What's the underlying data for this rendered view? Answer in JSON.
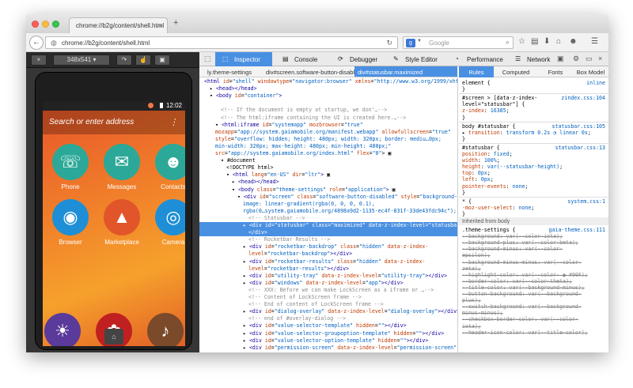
{
  "browser": {
    "tab_title": "chrome://b2g/content/shell.html",
    "url": "chrome://b2g/content/shell.html",
    "search_placeholder": "Google",
    "search_engine": "g"
  },
  "simulator": {
    "size_label": "348x541",
    "status_time": "12:02",
    "search_placeholder": "Search or enter address",
    "apps": [
      {
        "label": "Phone",
        "icon": "phone-icon",
        "glyph": "☏",
        "color": "#2ba897"
      },
      {
        "label": "Messages",
        "icon": "messages-icon",
        "glyph": "✉",
        "color": "#2ba897"
      },
      {
        "label": "Contacts",
        "icon": "contacts-icon",
        "glyph": "☻",
        "color": "#2ba897"
      },
      {
        "label": "Browser",
        "icon": "browser-icon",
        "glyph": "◉",
        "color": "#1e8fd6"
      },
      {
        "label": "Marketplace",
        "icon": "marketplace-icon",
        "glyph": "▲",
        "color": "#e2552a"
      },
      {
        "label": "Camera",
        "icon": "camera-icon",
        "glyph": "◎",
        "color": "#1e8fd6"
      }
    ]
  },
  "devtools": {
    "tabs": [
      "Inspector",
      "Console",
      "Debugger",
      "Style Editor",
      "Performance",
      "Network"
    ],
    "breadcrumbs": [
      "ly.theme-settings",
      "div#screen.software-button-disabled",
      "div#statusbar.maximized"
    ],
    "markup": [
      {
        "html": "<span class='tg'>&lt;html</span> <span class='at'>id</span>=<span class='av'>\"shell\"</span> <span class='at'>windowtype</span>=<span class='av'>\"navigator:browser\"</span> <span class='at'>xmlns</span>=<span class='av'>\"http://www.w3.org/1999/xhtml\"</span>&gt; ▣",
        "indent": 0
      },
      {
        "html": "▸ <span class='tg'>&lt;head&gt;&lt;/head&gt;</span>",
        "indent": 1
      },
      {
        "html": "▾ <span class='tg'>&lt;body</span> <span class='at'>id</span>=<span class='av'>\"container\"</span><span class='tg'>&gt;</span>",
        "indent": 1
      },
      {
        "html": "",
        "indent": 0
      },
      {
        "html": "<span class='cm'>&lt;!--     If the document is empty at startup, we don'…--&gt;</span>",
        "indent": 3
      },
      {
        "html": "<span class='cm'>&lt;!-- The html:iframe containing the UI is created here.…--&gt;</span>",
        "indent": 3
      },
      {
        "html": "▾ <span class='tg'>&lt;html:iframe</span> <span class='at'>id</span>=<span class='av'>\"systemapp\"</span> <span class='at'>mozbrowser</span>=<span class='av'>\"true\"</span>",
        "indent": 2
      },
      {
        "html": "<span class='at'>mozapp</span>=<span class='av'>\"app://system.gaiamobile.org/manifest.webapp\"</span> <span class='at'>allowfullscreen</span>=<span class='av'>\"true\"</span>",
        "indent": 2
      },
      {
        "html": "<span class='at'>style</span>=<span class='av'>\"overflow: hidden; height: 480px; width: 320px; border: mediu…0px;</span>",
        "indent": 2
      },
      {
        "html": "<span class='av'>min-width: 320px; max-height: 480px; min-height: 480px;\"</span>",
        "indent": 2
      },
      {
        "html": "<span class='at'>src</span>=<span class='av'>\"app://system.gaiamobile.org/index.html\"</span> <span class='at'>flex</span>=<span class='av'>\"0\"</span>&gt; ▣",
        "indent": 2
      },
      {
        "html": "▾ #document",
        "indent": 3
      },
      {
        "html": "&lt;!DOCTYPE html&gt;",
        "indent": 4
      },
      {
        "html": "▾ <span class='tg'>&lt;html</span> <span class='at'>lang</span>=<span class='av'>\"en-US\"</span> <span class='at'>dir</span>=<span class='av'>\"ltr\"</span><span class='tg'>&gt;</span> ▣",
        "indent": 4
      },
      {
        "html": "▸ <span class='tg'>&lt;head&gt;&lt;/head&gt;</span>",
        "indent": 5
      },
      {
        "html": "▾ <span class='tg'>&lt;body</span> <span class='at'>class</span>=<span class='av'>\"theme-settings\"</span> <span class='at'>role</span>=<span class='av'>\"application\"</span><span class='tg'>&gt;</span> ▣",
        "indent": 5
      },
      {
        "html": "▾ <span class='tg'>&lt;div</span> <span class='at'>id</span>=<span class='av'>\"screen\"</span> <span class='at'>class</span>=<span class='av'>\"software-button-disabled\"</span> <span class='at'>style</span>=<span class='av'>\"background-</span>",
        "indent": 6
      },
      {
        "html": "<span class='av'>image: linear-gradient(rgba(0, 0, 0, 0.1),</span>",
        "indent": 7
      },
      {
        "html": "<span class='av'>rgba(0…system.gaiamobile.org/4898a9d2-1135-ec4f-831f-33de43fdc94c\");\"</span>&gt; ▣",
        "indent": 7
      },
      {
        "html": "<span class='cm'>&lt;!-- Statusbar --&gt;</span>",
        "indent": 8
      },
      {
        "html": "▸ <span class='tg'>&lt;div</span> <span class='at'>id</span>=<span class='av'>\"statusbar\"</span> <span class='at'>class</span>=<span class='av'>\"maximized\"</span> <span class='at'>data-z-index-level</span>=<span class='av'>\"statusbar\"</span><span class='tg'>&gt;</span>",
        "indent": 7,
        "selected": true
      },
      {
        "html": "<span class='tg'>&lt;/div&gt;</span>",
        "indent": 8,
        "selected": true
      },
      {
        "html": "<span class='cm'>&lt;!-- Rocketbar Results --&gt;</span>",
        "indent": 8
      },
      {
        "html": "▸ <span class='tg'>&lt;div</span> <span class='at'>id</span>=<span class='av'>\"rocketbar-backdrop\"</span> <span class='at'>class</span>=<span class='av'>\"hidden\"</span> <span class='at'>data-z-index-</span>",
        "indent": 7
      },
      {
        "html": "<span class='at'>level</span>=<span class='av'>\"rocketbar-backdrop\"</span><span class='tg'>&gt;&lt;/div&gt;</span>",
        "indent": 8
      },
      {
        "html": "▸ <span class='tg'>&lt;div</span> <span class='at'>id</span>=<span class='av'>\"rocketbar-results\"</span> <span class='at'>class</span>=<span class='av'>\"hidden\"</span> <span class='at'>data-z-index-</span>",
        "indent": 7
      },
      {
        "html": "<span class='at'>level</span>=<span class='av'>\"rocketbar-results\"</span><span class='tg'>&gt;&lt;/div&gt;</span>",
        "indent": 8
      },
      {
        "html": "▸ <span class='tg'>&lt;div</span> <span class='at'>id</span>=<span class='av'>\"utility-tray\"</span> <span class='at'>data-z-index-level</span>=<span class='av'>\"utility-tray\"</span><span class='tg'>&gt;&lt;/div&gt;</span>",
        "indent": 7
      },
      {
        "html": "▸ <span class='tg'>&lt;div</span> <span class='at'>id</span>=<span class='av'>\"windows\"</span> <span class='at'>data-z-index-level</span>=<span class='av'>\"app\"</span><span class='tg'>&gt;&lt;/div&gt;</span>",
        "indent": 7
      },
      {
        "html": "<span class='cm'>&lt;!-- XXX: Before we can make LockScreen as a iframe or …--&gt;</span>",
        "indent": 8
      },
      {
        "html": "<span class='cm'>&lt;!-- Content of LockScreen frame --&gt;</span>",
        "indent": 8
      },
      {
        "html": "<span class='cm'>&lt;!-- End of content of LockScreen frame --&gt;</span>",
        "indent": 8
      },
      {
        "html": "▸ <span class='tg'>&lt;div</span> <span class='at'>id</span>=<span class='av'>\"dialog-overlay\"</span> <span class='at'>data-z-index-level</span>=<span class='av'>\"dialog-overlay\"</span><span class='tg'>&gt;&lt;/div&gt;</span>",
        "indent": 7
      },
      {
        "html": "<span class='cm'>&lt;!-- end of #overlay-dialog --&gt;</span>",
        "indent": 8
      },
      {
        "html": "▸ <span class='tg'>&lt;div</span> <span class='at'>id</span>=<span class='av'>\"value-selector-template\"</span> <span class='at'>hidden</span>=<span class='av'>\"\"</span><span class='tg'>&gt;&lt;/div&gt;</span>",
        "indent": 7
      },
      {
        "html": "▸ <span class='tg'>&lt;div</span> <span class='at'>id</span>=<span class='av'>\"value-selector-groupoption-template\"</span> <span class='at'>hidden</span>=<span class='av'>\"\"</span><span class='tg'>&gt;&lt;/div&gt;</span>",
        "indent": 7
      },
      {
        "html": "▸ <span class='tg'>&lt;div</span> <span class='at'>id</span>=<span class='av'>\"value-selector-option-template\"</span> <span class='at'>hidden</span>=<span class='av'>\"\"</span><span class='tg'>&gt;&lt;/div&gt;</span>",
        "indent": 7
      },
      {
        "html": "▸ <span class='tg'>&lt;div</span> <span class='at'>id</span>=<span class='av'>\"permission-screen\"</span> <span class='at'>data-z-index-level</span>=<span class='av'>\"permission-screen\"</span>",
        "indent": 7
      }
    ],
    "rule_tabs": [
      "Rules",
      "Computed",
      "Fonts",
      "Box Model"
    ],
    "rules": [
      {
        "left": "element {",
        "src": "inline"
      },
      {
        "left": "}",
        "src": ""
      },
      {
        "sep": true
      },
      {
        "left": "#screen &gt; [data-z-index-",
        "src": "zindex.css:104"
      },
      {
        "left": "level=\"statusbar\"] {",
        "src": ""
      },
      {
        "left": "  <span class='prop'>z-index</span>: <span class='val'>16385</span>;",
        "src": ""
      },
      {
        "left": "}",
        "src": ""
      },
      {
        "sep": true
      },
      {
        "left": "body #statusbar {",
        "src": "statusbar.css:105"
      },
      {
        "left": "  ▸ <span class='prop'>transition</span>: <span class='val'>transform 0.2s ◔ linear 0s</span>;",
        "src": ""
      },
      {
        "left": "}",
        "src": ""
      },
      {
        "sep": true
      },
      {
        "left": "#statusbar {",
        "src": "statusbar.css:13"
      },
      {
        "left": "    <span class='prop'>position</span>: <span class='val'>fixed</span>;",
        "src": ""
      },
      {
        "left": "    <span class='prop'>width</span>: <span class='val'>100%</span>;",
        "src": ""
      },
      {
        "left": "    <span class='prop'>height</span>: <span class='val'>var(--statusbar-height)</span>;",
        "src": ""
      },
      {
        "left": "    <span class='prop'>top</span>: <span class='val'>0px</span>;",
        "src": ""
      },
      {
        "left": "    <span class='prop'>left</span>: <span class='val'>0px</span>;",
        "src": ""
      },
      {
        "left": "    <span class='prop'>pointer-events</span>: <span class='val'>none</span>;",
        "src": ""
      },
      {
        "left": "}",
        "src": ""
      },
      {
        "sep": true
      },
      {
        "left": "* {",
        "src": "system.css:1"
      },
      {
        "left": "    <span class='prop'>-moz-user-select</span>: <span class='val'>none</span>;",
        "src": ""
      },
      {
        "left": "}",
        "src": ""
      },
      {
        "inherit": "Inherited from body"
      },
      {
        "left": ".theme-settings {",
        "src": "gaia-theme.css:111"
      },
      {
        "left": "    --background: var(--color-iota);",
        "src": "",
        "strike": true
      },
      {
        "left": "    --background-plus: var(--color-beta);",
        "src": "",
        "strike": true
      },
      {
        "left": "    --background-minus: var(--color-",
        "src": "",
        "strike": true
      },
      {
        "left": "epsilon);",
        "src": "",
        "strike": true
      },
      {
        "left": "    --background-minus-minus: var(--color-",
        "src": "",
        "strike": true
      },
      {
        "left": "zeta);",
        "src": "",
        "strike": true
      },
      {
        "left": "    --highlight-color: var(--color- ● #00F);",
        "src": "",
        "strike": true
      },
      {
        "left": "    --border-color: var(--color-theta);",
        "src": "",
        "strike": true
      },
      {
        "left": "    --title-color: var(--background-minus);",
        "src": "",
        "strike": true
      },
      {
        "left": "    --button-background: var(--background-",
        "src": "",
        "strike": true
      },
      {
        "left": "plus);",
        "src": "",
        "strike": true
      },
      {
        "left": "    --switch-background: var(--background-",
        "src": "",
        "strike": true
      },
      {
        "left": "minus-minus);",
        "src": "",
        "strike": true
      },
      {
        "left": "    --checkbox-border-color: var(--color-",
        "src": "",
        "strike": true
      },
      {
        "left": "iota);",
        "src": "",
        "strike": true
      },
      {
        "left": "    --header-icon-color: var(--title-color);",
        "src": "",
        "strike": true
      }
    ]
  }
}
